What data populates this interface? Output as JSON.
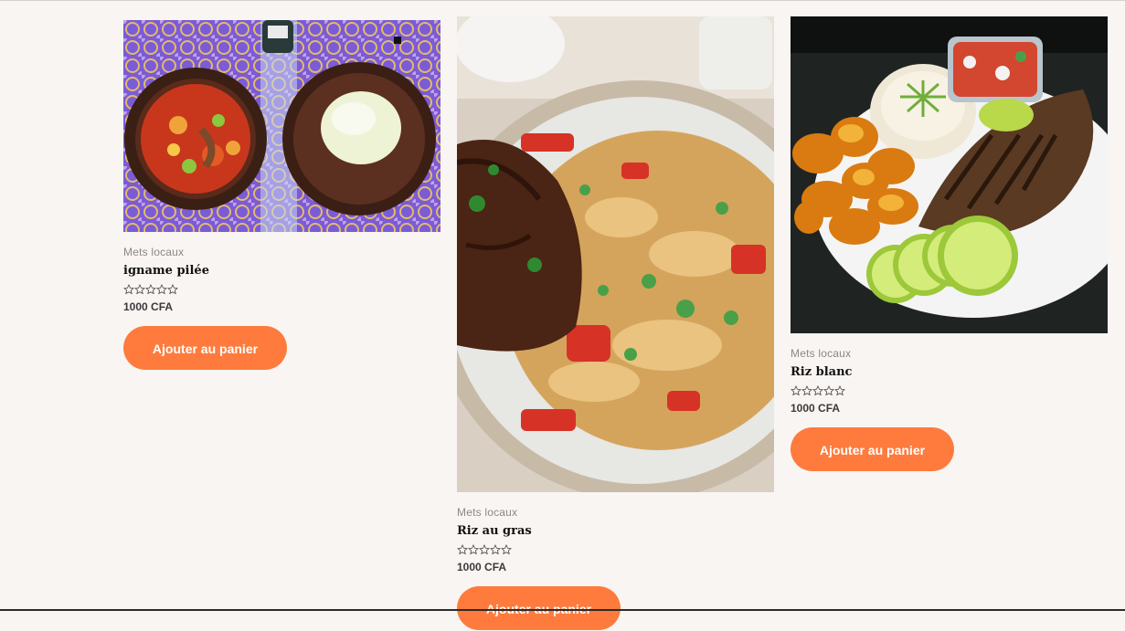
{
  "colors": {
    "background": "#f9f5f3",
    "button": "#fe7b3d",
    "button_text": "#ffffff"
  },
  "products": [
    {
      "category": "Mets locaux",
      "title": "igname pilée",
      "price": "1000 CFA",
      "rating_stars": 5,
      "rating_value": 0,
      "button_label": "Ajouter au panier",
      "image_alt": "igname pilée"
    },
    {
      "category": "Mets locaux",
      "title": "Riz au gras",
      "price": "1000 CFA",
      "rating_stars": 5,
      "rating_value": 0,
      "button_label": "Ajouter au panier",
      "image_alt": "Riz au gras"
    },
    {
      "category": "Mets locaux",
      "title": "Riz blanc",
      "price": "1000 CFA",
      "rating_stars": 5,
      "rating_value": 0,
      "button_label": "Ajouter au panier",
      "image_alt": "Riz blanc"
    }
  ]
}
